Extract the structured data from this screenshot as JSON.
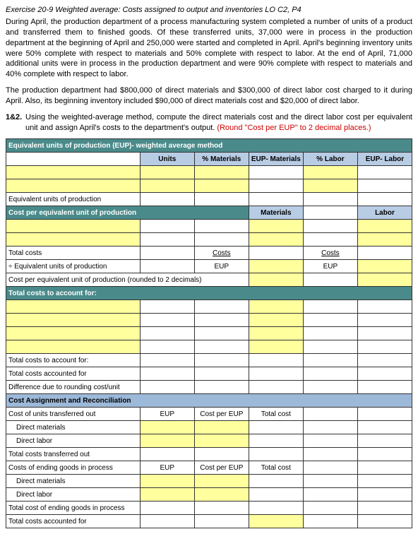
{
  "title": "Exercise 20-9 Weighted average: Costs assigned to output and inventories LO C2, P4",
  "para1": "During April, the production department of a process manufacturing system completed a number of units of a product and transferred them to finished goods. Of these transferred units, 37,000 were in process in the production department at the beginning of April and 250,000 were started and completed in April. April's beginning inventory units were 50% complete with respect to materials and 50% complete with respect to labor. At the end of April, 71,000 additional units were in process in the production department and were 90% complete with respect to materials and 40% complete with respect to labor.",
  "para2": "The production department had $800,000 of direct materials and $300,000 of direct labor cost charged to it during April. Also, its beginning inventory included $90,000 of direct materials cost and $20,000 of direct labor.",
  "q_num": "1&2.",
  "q_txt1": "Using the weighted-average method, compute the direct materials cost and the direct labor cost per equivalent unit and assign April's costs to the department's output. ",
  "q_txt2": "(Round \"Cost per EUP\" to 2 decimal places.)",
  "h": {
    "main": "Equivalent units of production (EUP)- weighted average method",
    "units": "Units",
    "pmat": "% Materials",
    "eupm": "EUP- Materials",
    "plab": "% Labor",
    "eupl": "EUP- Labor"
  },
  "r": {
    "eup": "Equivalent units of production",
    "cpeu": "Cost per equivalent unit of production",
    "materials": "Materials",
    "labor": "Labor",
    "totalcosts": "Total costs",
    "costs": "Costs",
    "diveup": "÷ Equivalent units of production",
    "eup_short": "EUP",
    "cpeu2": "Cost per equivalent unit of production (rounded to 2 decimals)",
    "tcaf": "Total costs to account for:",
    "tcaf2": "Total costs to account for:",
    "tca": "Total costs accounted for",
    "diff": "Difference due to rounding cost/unit",
    "car": "Cost Assignment and Reconciliation",
    "cuto": "Cost of units transferred out",
    "cpe": "Cost per EUP",
    "totalcost": "Total cost",
    "dm": "Direct materials",
    "dl": "Direct labor",
    "tcto": "Total costs transferred out",
    "cegip": "Costs of ending goods in process",
    "tcegip": "Total cost of ending goods in process",
    "tca2": "Total costs accounted for"
  }
}
